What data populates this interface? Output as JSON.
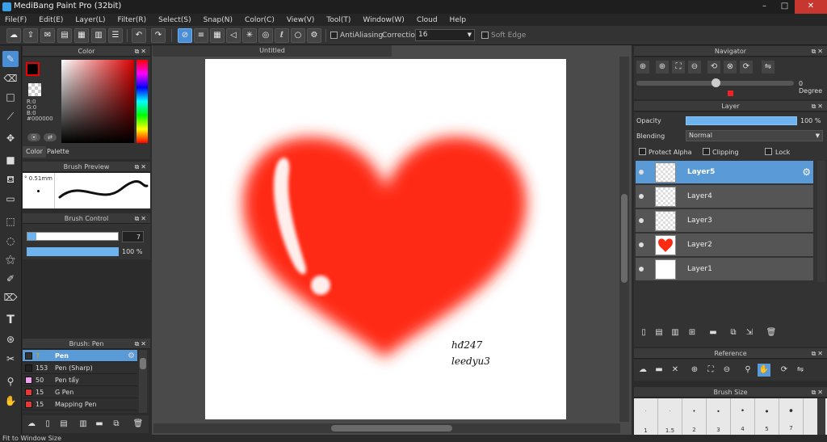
{
  "window": {
    "title": "MediBang Paint Pro (32bit)",
    "min": "–",
    "max": "□",
    "close": "✕"
  },
  "menu": [
    "File(F)",
    "Edit(E)",
    "Layer(L)",
    "Filter(R)",
    "Select(S)",
    "Snap(N)",
    "Color(C)",
    "View(V)",
    "Tool(T)",
    "Window(W)",
    "Cloud",
    "Help"
  ],
  "toolbar": {
    "antialiasing_label": "AntiAliasing",
    "correction_label": "Correction",
    "correction_value": "16",
    "soft_edge_label": "Soft Edge"
  },
  "color_panel": {
    "title": "Color",
    "r": "R:0",
    "g": "G:0",
    "b": "B:0",
    "hex": "#000000",
    "tab_color": "Color",
    "tab_palette": "Palette"
  },
  "brush_preview": {
    "title": "Brush Preview",
    "size_text": "0.51mm"
  },
  "brush_control": {
    "title": "Brush Control",
    "size_value": "7",
    "size_fraction": 0.1,
    "opacity_value": "100 %",
    "opacity_fraction": 1.0
  },
  "brush_list": {
    "title": "Brush: Pen",
    "items": [
      {
        "size": "7",
        "name": "Pen",
        "color": "#333333",
        "selected": true
      },
      {
        "size": "153",
        "name": "Pen (Sharp)",
        "color": "#222222",
        "selected": false
      },
      {
        "size": "50",
        "name": "Pen tẩy",
        "color": "#f0a0f0",
        "selected": false
      },
      {
        "size": "15",
        "name": "G Pen",
        "color": "#e53935",
        "selected": false
      },
      {
        "size": "15",
        "name": "Mapping Pen",
        "color": "#e53935",
        "selected": false
      }
    ]
  },
  "canvas": {
    "doc_title": "Untitled",
    "signature_line1": "hđ247",
    "signature_line2": "leedyu3"
  },
  "navigator": {
    "title": "Navigator",
    "rotation": "0 Degree"
  },
  "layer_panel": {
    "title": "Layer",
    "opacity_label": "Opacity",
    "opacity_value": "100 %",
    "blending_label": "Blending",
    "blending_value": "Normal",
    "protect_alpha": "Protect Alpha",
    "clipping": "Clipping",
    "lock": "Lock",
    "layers": [
      {
        "name": "Layer5",
        "selected": true
      },
      {
        "name": "Layer4",
        "selected": false
      },
      {
        "name": "Layer3",
        "selected": false
      },
      {
        "name": "Layer2",
        "selected": false
      },
      {
        "name": "Layer1",
        "selected": false
      }
    ]
  },
  "reference": {
    "title": "Reference"
  },
  "brush_size": {
    "title": "Brush Size",
    "sizes": [
      "1",
      "1.5",
      "2",
      "3",
      "4",
      "5",
      "7"
    ]
  },
  "status": {
    "text": "Fit to Window Size"
  },
  "colors": {
    "accent": "#5a9ad6",
    "heart": "#ff2a12"
  }
}
